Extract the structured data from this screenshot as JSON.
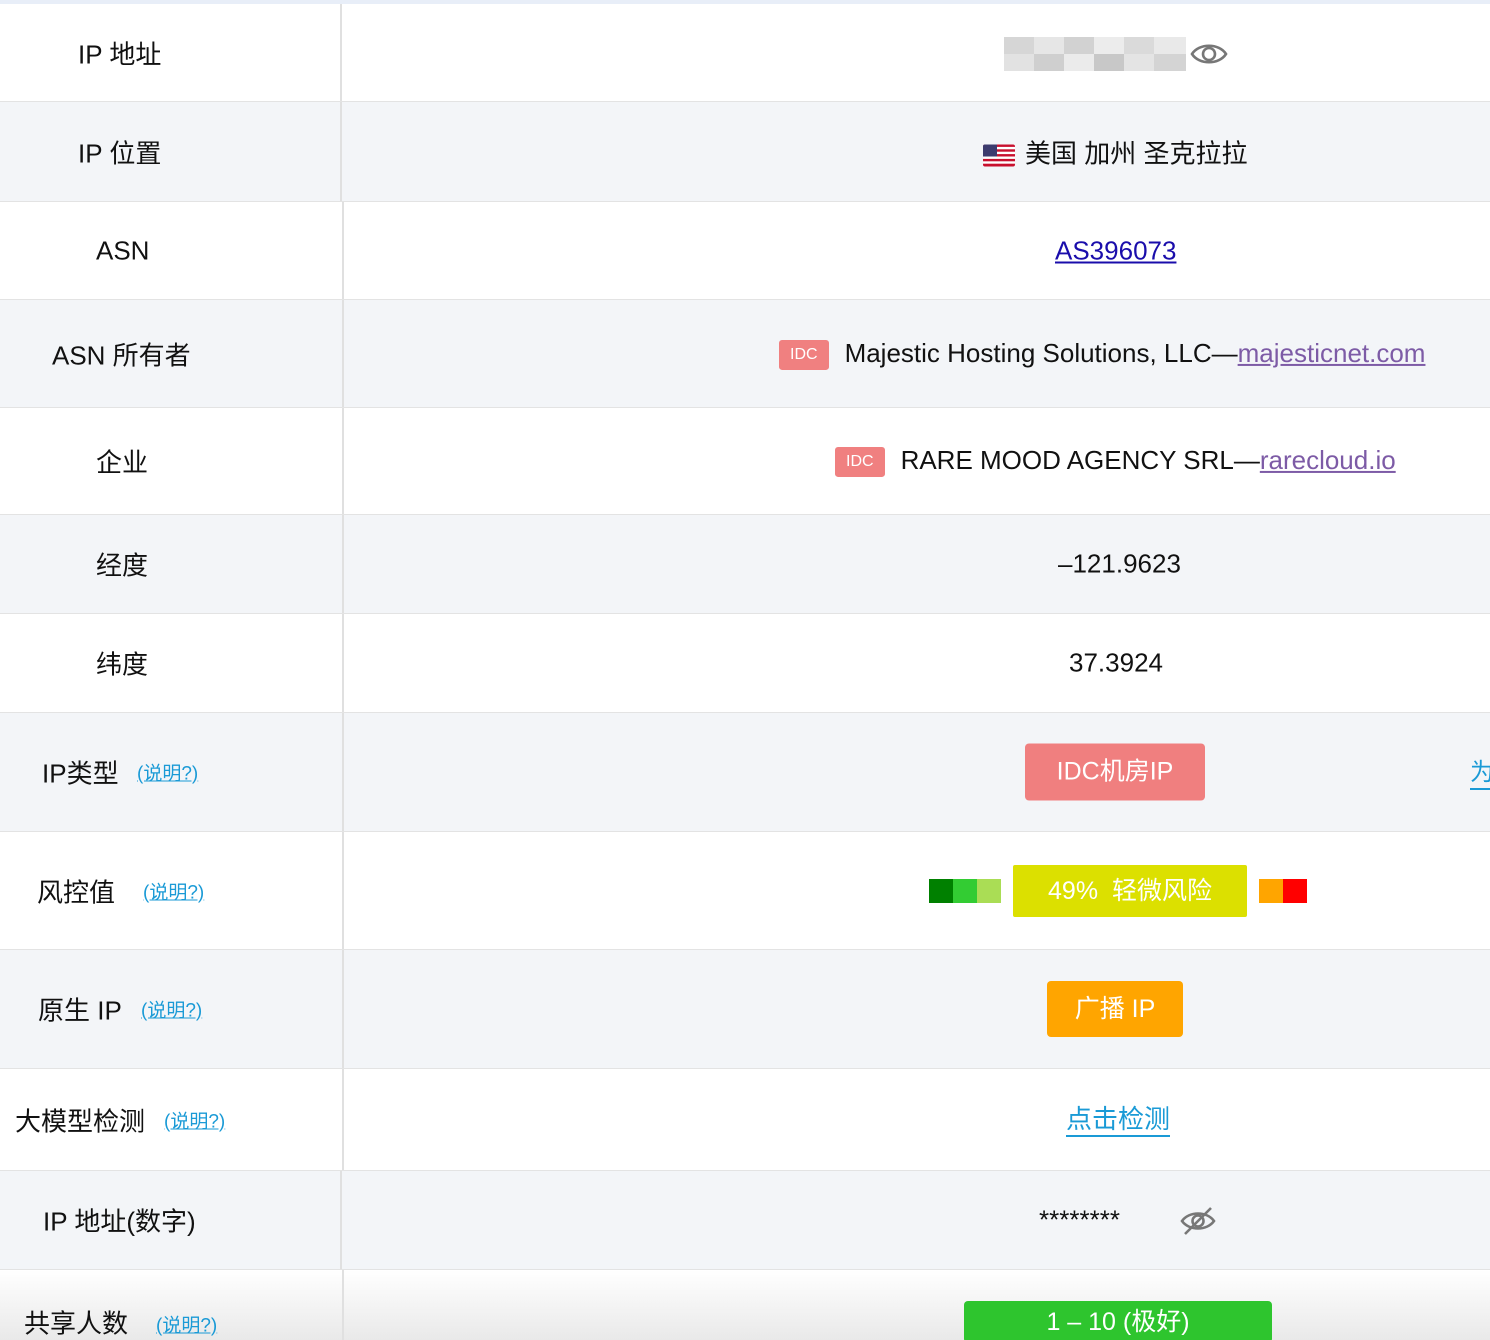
{
  "rows": [
    {
      "label": "IP 地址",
      "icon": "eye-icon"
    },
    {
      "label": "IP 位置",
      "value": "美国 加州 圣克拉拉",
      "flag": "us-flag-icon"
    },
    {
      "label": "ASN",
      "value": "AS396073"
    },
    {
      "label": "ASN 所有者",
      "badge": "IDC",
      "value": "Majestic Hosting Solutions, LLC—",
      "link": "majesticnet.com"
    },
    {
      "label": "企业",
      "badge": "IDC",
      "value": "RARE MOOD AGENCY SRL—",
      "link": "rarecloud.io"
    },
    {
      "label": "经度",
      "value": "–121.9623"
    },
    {
      "label": "纬度",
      "value": "37.3924"
    },
    {
      "label": "IP类型",
      "help": "(说明?)",
      "value": "IDC机房IP",
      "color": "#f07f7f",
      "side_link": "为"
    },
    {
      "label": "风控值",
      "help": "(说明?)",
      "value": "49%  轻微风险",
      "color": "#dce000",
      "risk_percent": 49
    },
    {
      "label": "原生 IP",
      "help": "(说明?)",
      "value": "广播 IP",
      "color": "#ffa500"
    },
    {
      "label": "大模型检测",
      "help": "(说明?)",
      "value": "点击检测"
    },
    {
      "label": "IP 地址(数字)",
      "value": "********",
      "icon": "eye-off-icon"
    },
    {
      "label": "共享人数",
      "help": "(说明?)",
      "value": "1 – 10 (极好)",
      "color": "#2ec52e"
    }
  ],
  "risk_scale_colors": [
    "#008000",
    "#33cc33",
    "#aadd55",
    "#ffa500",
    "#ff0000"
  ]
}
